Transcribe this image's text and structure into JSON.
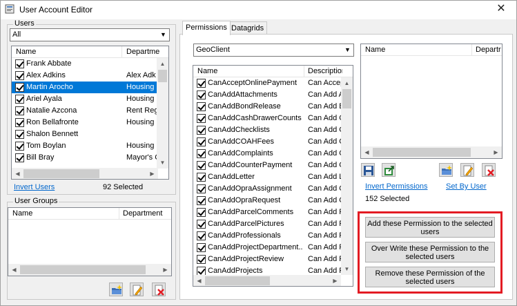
{
  "window": {
    "title": "User Account Editor",
    "close_glyph": "✕"
  },
  "users": {
    "legend": "Users",
    "filter_value": "All",
    "columns": [
      "Name",
      "Departme"
    ],
    "rows": [
      {
        "name": "Frank Abbate",
        "dept": ""
      },
      {
        "name": "Alex Adkins",
        "dept": "Alex Adk"
      },
      {
        "name": "Martin Arocho",
        "dept": "Housing"
      },
      {
        "name": "Ariel Ayala",
        "dept": "Housing"
      },
      {
        "name": "Natalie Azcona",
        "dept": "Rent Reg"
      },
      {
        "name": "Ron Bellafronte",
        "dept": "Housing"
      },
      {
        "name": "Shalon Bennett",
        "dept": ""
      },
      {
        "name": "Tom Boylan",
        "dept": "Housing"
      },
      {
        "name": "Bill Bray",
        "dept": "Mayor's C"
      }
    ],
    "selected_index": 2,
    "invert_link": "Invert Users",
    "selected_count": "92 Selected"
  },
  "user_groups": {
    "legend": "User Groups",
    "columns": [
      "Name",
      "Department"
    ]
  },
  "tabs": [
    "Permissions",
    "Datagrids"
  ],
  "permissions": {
    "module_value": "GeoClient",
    "columns": [
      "Name",
      "Description"
    ],
    "rows": [
      {
        "name": "CanAcceptOnlinePayment",
        "desc": "Can Accept"
      },
      {
        "name": "CanAddAttachments",
        "desc": "Can Add A"
      },
      {
        "name": "CanAddBondRelease",
        "desc": "Can Add B"
      },
      {
        "name": "CanAddCashDrawerCounts",
        "desc": "Can Add C"
      },
      {
        "name": "CanAddChecklists",
        "desc": "Can Add C"
      },
      {
        "name": "CanAddCOAHFees",
        "desc": "Can Add C"
      },
      {
        "name": "CanAddComplaints",
        "desc": "Can Add C"
      },
      {
        "name": "CanAddCounterPayment",
        "desc": "Can Add C"
      },
      {
        "name": "CanAddLetter",
        "desc": "Can Add L"
      },
      {
        "name": "CanAddOpraAssignment",
        "desc": "Can Add O"
      },
      {
        "name": "CanAddOpraRequest",
        "desc": "Can Add O"
      },
      {
        "name": "CanAddParcelComments",
        "desc": "Can Add P"
      },
      {
        "name": "CanAddParcelPictures",
        "desc": "Can Add P"
      },
      {
        "name": "CanAddProfessionals",
        "desc": "Can Add P"
      },
      {
        "name": "CanAddProjectDepartment...",
        "desc": "Can Add P"
      },
      {
        "name": "CanAddProjectReview",
        "desc": "Can Add P"
      },
      {
        "name": "CanAddProjects",
        "desc": "Can Add P"
      }
    ]
  },
  "assigned": {
    "columns": [
      "Name",
      "Departr"
    ],
    "invert_link": "Invert Permissions",
    "set_by_user_link": "Set By User",
    "selected_count": "152 Selected"
  },
  "actions": {
    "add": "Add these Permission to the selected users",
    "overwrite": "Over Write these Permission to the selected users",
    "remove": "Remove these Permission of the selected users"
  },
  "icons": {
    "save": "save-icon",
    "export": "export-icon",
    "new": "new-item-icon",
    "edit": "edit-icon",
    "delete": "delete-icon"
  },
  "colors": {
    "selection": "#0078d7",
    "link": "#0066cc",
    "highlight_frame": "#e31b23"
  }
}
